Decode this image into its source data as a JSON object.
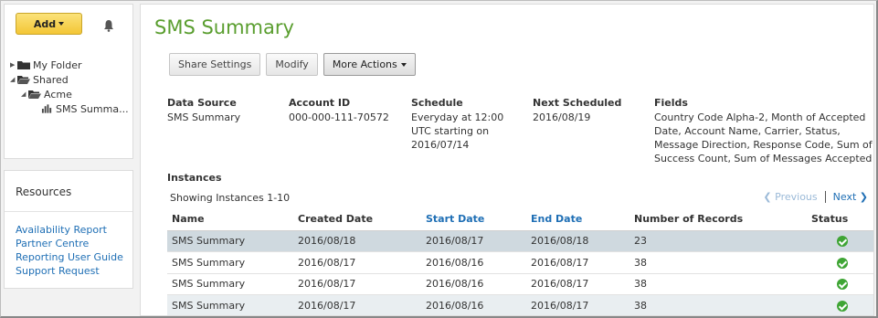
{
  "sidebar": {
    "add_label": "Add",
    "tree": [
      {
        "label": "My Folder",
        "icon": "folder-icon",
        "toggle": "collapsed"
      },
      {
        "label": "Shared",
        "icon": "folder-open-icon",
        "toggle": "expanded"
      },
      {
        "label": "Acme",
        "icon": "folder-open-icon",
        "toggle": "expanded"
      },
      {
        "label": "SMS Summa...",
        "icon": "bar-chart-icon",
        "toggle": "none"
      }
    ],
    "resources_title": "Resources",
    "links": [
      "Availability Report",
      "Partner Centre",
      "Reporting User Guide",
      "Support Request"
    ]
  },
  "main": {
    "title": "SMS Summary",
    "toolbar": {
      "share": "Share Settings",
      "modify": "Modify",
      "more": "More Actions"
    },
    "meta": {
      "data_source": {
        "label": "Data Source",
        "value": "SMS Summary"
      },
      "account_id": {
        "label": "Account ID",
        "value": "000-000-111-70572"
      },
      "schedule": {
        "label": "Schedule",
        "lines": [
          "Everyday at 12:00",
          "UTC starting on",
          "2016/07/14"
        ]
      },
      "next_scheduled": {
        "label": "Next Scheduled",
        "value": "2016/08/19"
      },
      "fields": {
        "label": "Fields",
        "lines": [
          "Country Code Alpha-2, Month of Accepted",
          "Date, Account Name, Carrier, Status,",
          "Message Direction, Response Code, Sum of",
          "Success Count, Sum of Messages Accepted"
        ]
      }
    },
    "instances": {
      "title": "Instances",
      "showing": "Showing Instances 1-10",
      "prev": "Previous",
      "next": "Next",
      "columns": [
        "Name",
        "Created Date",
        "Start Date",
        "End Date",
        "Number of Records",
        "Status"
      ],
      "rows": [
        {
          "name": "SMS Summary",
          "created": "2016/08/18",
          "start": "2016/08/17",
          "end": "2016/08/18",
          "records": "23",
          "status": "success"
        },
        {
          "name": "SMS Summary",
          "created": "2016/08/17",
          "start": "2016/08/16",
          "end": "2016/08/17",
          "records": "38",
          "status": "success"
        },
        {
          "name": "SMS Summary",
          "created": "2016/08/17",
          "start": "2016/08/16",
          "end": "2016/08/17",
          "records": "38",
          "status": "success"
        },
        {
          "name": "SMS Summary",
          "created": "2016/08/17",
          "start": "2016/08/16",
          "end": "2016/08/17",
          "records": "38",
          "status": "success"
        }
      ]
    }
  },
  "colors": {
    "title_green": "#5a9e2f",
    "link_blue": "#1f6fb5",
    "add_yellow": "#f3c635",
    "status_green": "#3fa535"
  }
}
